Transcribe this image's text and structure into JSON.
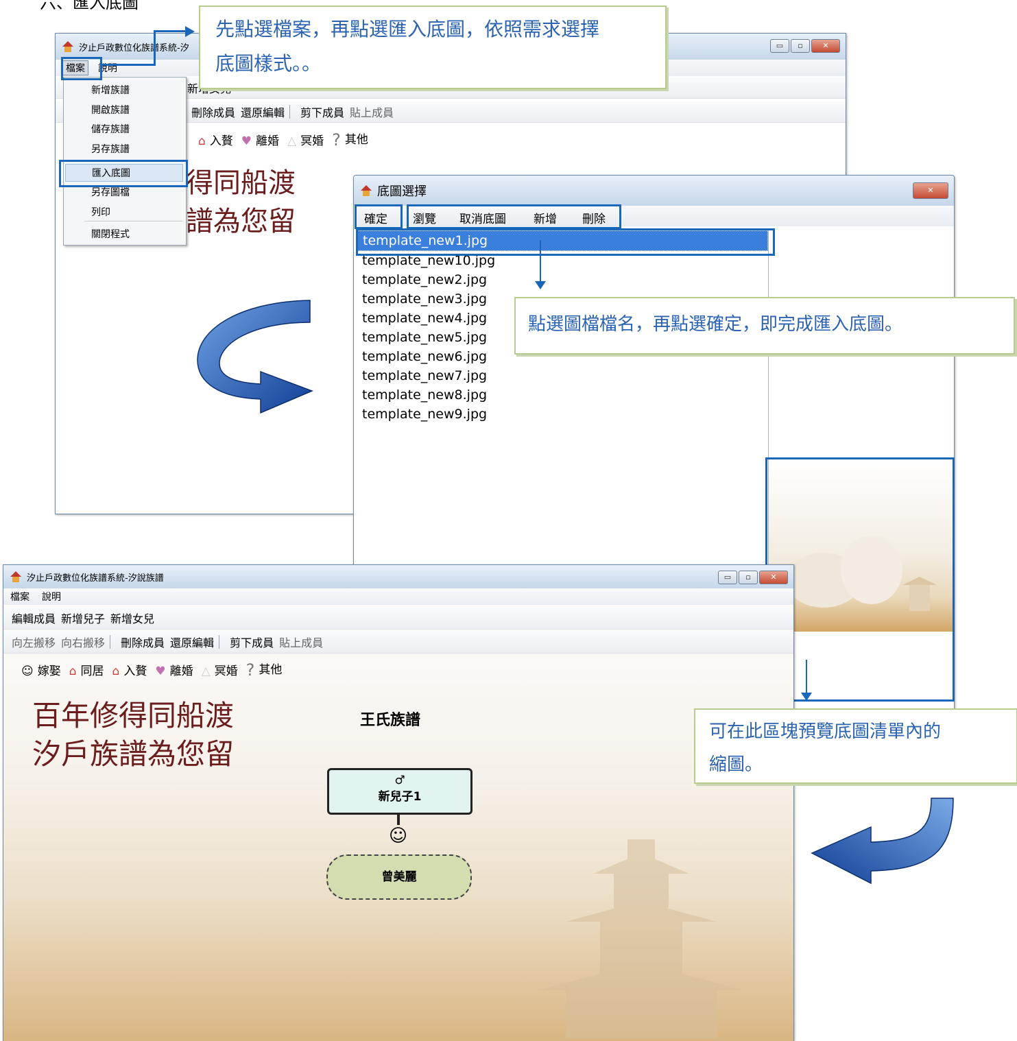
{
  "heading": "六、匯入底圖",
  "callout1": {
    "line1": "先點選檔案，再點選匯入底圖，依照需求選擇",
    "line2": "底圖樣式。。"
  },
  "callout2": {
    "text": "點選圖檔檔名，再點選確定，即完成匯入底圖。"
  },
  "callout3": {
    "line1": "可在此區塊預覽底圖清單內的",
    "line2": "縮圖。"
  },
  "win1": {
    "title": "汐止戶政數位化族譜系統-汐",
    "menu": {
      "file": "檔案",
      "help": "說明"
    },
    "dropdown": [
      "新增族譜",
      "開啟族譜",
      "儲存族譜",
      "另存族譜",
      "匯入底圖",
      "另存圖檔",
      "列印",
      "關閉程式"
    ],
    "toolbar1_visible": "新增女兒",
    "toolbar2": [
      "刪除成員",
      "還原編輯",
      "剪下成員",
      "貼上成員"
    ],
    "relations": [
      "入贅",
      "離婚",
      "冥婚",
      "其他"
    ],
    "bg_line1": "得同船渡",
    "bg_line2": "譜為您留"
  },
  "dialog": {
    "title": "底圖選擇",
    "close_glyph": "✕",
    "buttons": {
      "ok": "確定",
      "browse": "瀏覽",
      "cancel_bg": "取消底圖",
      "add": "新增",
      "delete": "刪除"
    },
    "files": [
      "template_new1.jpg",
      "template_new10.jpg",
      "template_new2.jpg",
      "template_new3.jpg",
      "template_new4.jpg",
      "template_new5.jpg",
      "template_new6.jpg",
      "template_new7.jpg",
      "template_new8.jpg",
      "template_new9.jpg"
    ],
    "selected_index": 0
  },
  "win3": {
    "title": "汐止戶政數位化族譜系統-汐說族譜",
    "menu": {
      "file": "檔案",
      "help": "說明"
    },
    "toolbar1": [
      "編輯成員",
      "新增兒子",
      "新增女兒"
    ],
    "toolbar2": [
      "向左搬移",
      "向右搬移",
      "刪除成員",
      "還原編輯",
      "剪下成員",
      "貼上成員"
    ],
    "relations": [
      "嫁娶",
      "同居",
      "入贅",
      "離婚",
      "冥婚",
      "其他"
    ],
    "bg_line1": "百年修得同船渡",
    "bg_line2": "汐戶族譜為您留",
    "tree_title": "王氏族譜",
    "node1": {
      "symbol": "♂",
      "name": "新兒子1"
    },
    "node2": {
      "name": "曾美麗"
    }
  },
  "window_buttons": {
    "min": "▭",
    "max": "▫",
    "close": "✕"
  },
  "colors": {
    "highlight": "#1a66b8",
    "callout_border": "#b6cc8f",
    "callout_text": "#2b63b0",
    "arrow": "#1f56b3"
  }
}
